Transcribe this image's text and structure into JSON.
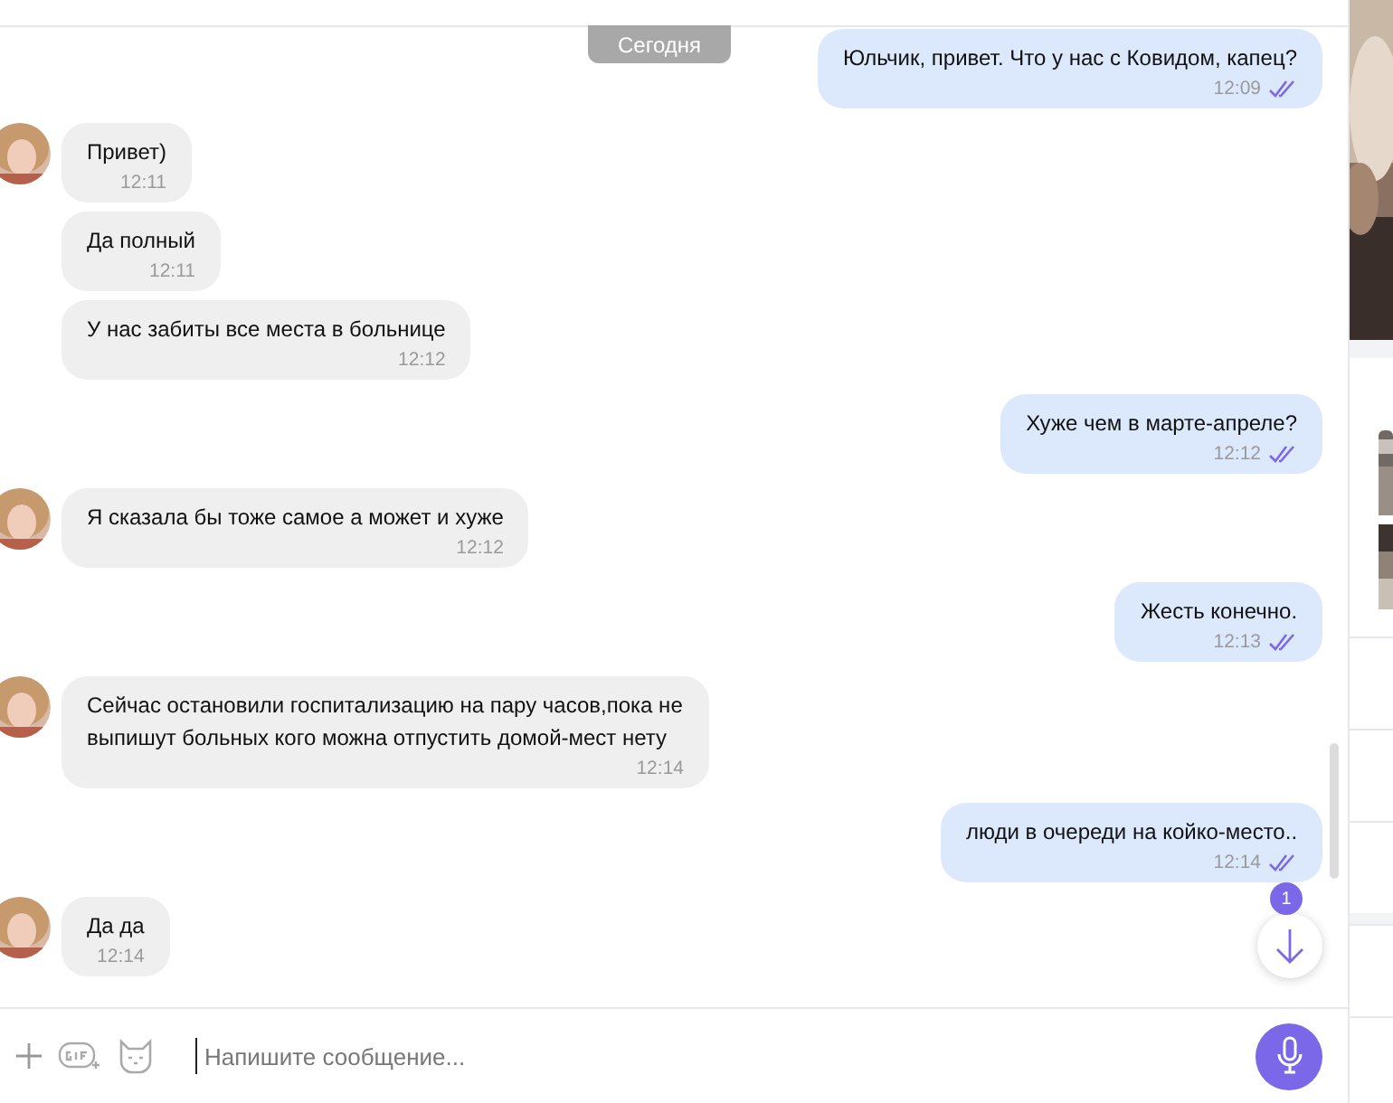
{
  "date_chip": "Сегодня",
  "messages": [
    {
      "kind": "outgoing",
      "text": "Юльчик, привет. Что у нас с Ковидом, капец?",
      "time": "12:09",
      "read": true
    },
    {
      "kind": "incoming",
      "avatar": true,
      "text": "Привет)",
      "time": "12:11"
    },
    {
      "kind": "incoming",
      "avatar": false,
      "text": "Да полный",
      "time": "12:11"
    },
    {
      "kind": "incoming",
      "avatar": false,
      "text": "У нас забиты все места в больнице",
      "time": "12:12"
    },
    {
      "kind": "outgoing",
      "text": "Хуже чем в марте-апреле?",
      "time": "12:12",
      "read": true
    },
    {
      "kind": "incoming",
      "avatar": true,
      "text": "Я сказала бы тоже самое а может и хуже",
      "time": "12:12"
    },
    {
      "kind": "outgoing",
      "text": "Жесть конечно.",
      "time": "12:13",
      "read": true
    },
    {
      "kind": "incoming",
      "avatar": true,
      "text": "Сейчас остановили госпитализацию на пару часов,пока не выпишут больных кого можна отпустить домой-мест нету",
      "time": "12:14"
    },
    {
      "kind": "outgoing",
      "text": "люди в очереди на койко-место..",
      "time": "12:14",
      "read": true
    },
    {
      "kind": "incoming",
      "avatar": true,
      "text": "Да да",
      "time": "12:14"
    }
  ],
  "scroll_down": {
    "badge": "1"
  },
  "composer": {
    "placeholder": "Напишите сообщение..."
  }
}
